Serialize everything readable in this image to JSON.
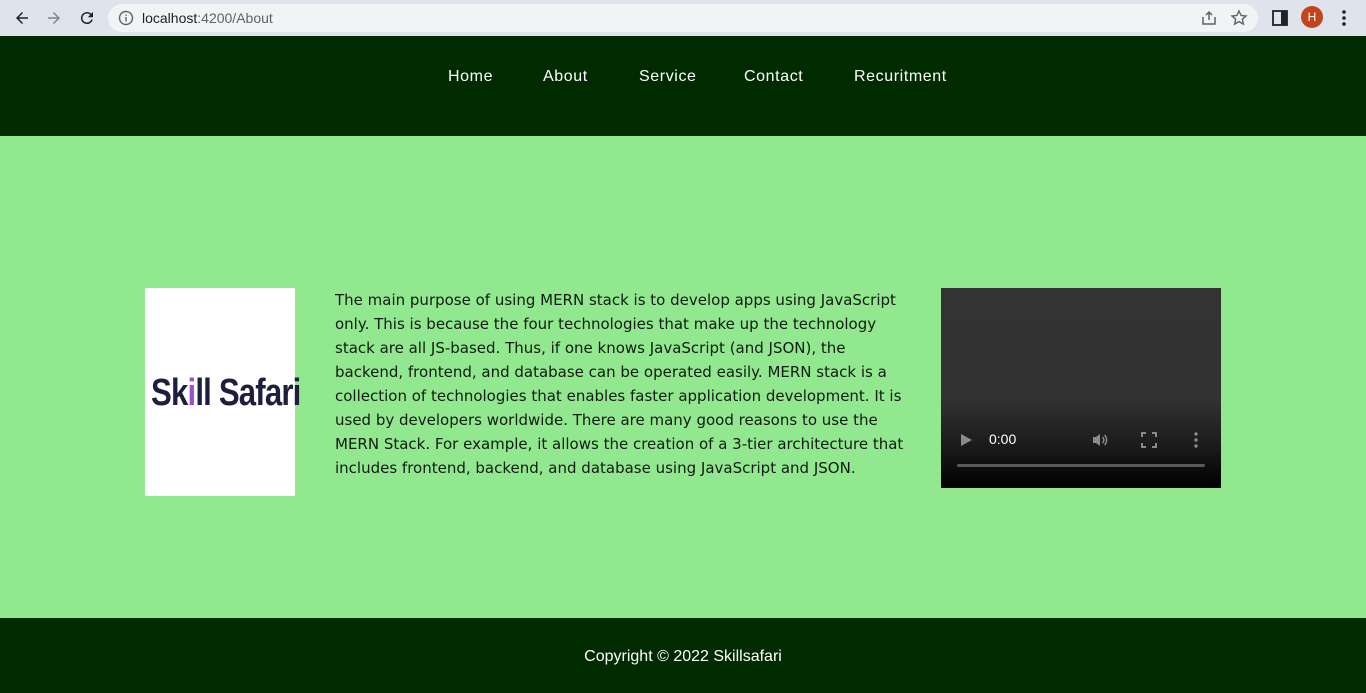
{
  "browser": {
    "url_host": "localhost",
    "url_path": ":4200/About",
    "profile_initial": "H"
  },
  "nav": {
    "items": [
      {
        "label": "Home"
      },
      {
        "label": "About"
      },
      {
        "label": "Service"
      },
      {
        "label": "Contact"
      },
      {
        "label": "Recuritment"
      }
    ]
  },
  "main": {
    "logo_text_part1": "Sk",
    "logo_text_accent": "i",
    "logo_text_part2": "ll Safari",
    "about_text": "The main purpose of using MERN stack is to develop apps using JavaScript only. This is because the four technologies that make up the technology stack are all JS-based. Thus, if one knows JavaScript (and JSON), the backend, frontend, and database can be operated easily. MERN stack is a collection of technologies that enables faster application development. It is used by developers worldwide. There are many good reasons to use the MERN Stack. For example, it allows the creation of a 3-tier architecture that includes frontend, backend, and database using JavaScript and JSON.",
    "video": {
      "time": "0:00",
      "progress": 0
    }
  },
  "footer": {
    "copyright": "Copyright © 2022 Skillsafari"
  },
  "colors": {
    "header_bg": "#002b00",
    "main_bg": "#92e88f",
    "footer_bg": "#002b00"
  }
}
